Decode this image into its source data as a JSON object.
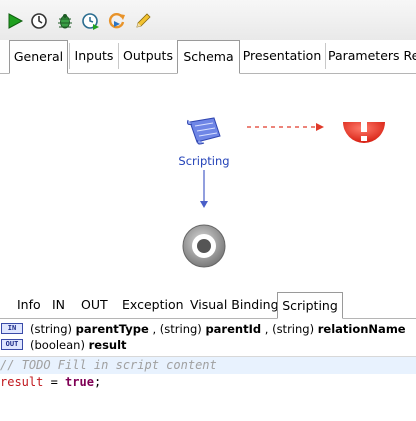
{
  "toolbar": {
    "icons": [
      "run-icon",
      "history-icon",
      "debug-icon",
      "schedule-icon",
      "refresh-icon",
      "edit-icon"
    ]
  },
  "top_tabs": [
    "General",
    "Inputs",
    "Outputs",
    "Schema",
    "Presentation",
    "Parameters Re"
  ],
  "top_tabs_selected": "Schema",
  "schema": {
    "node_label": "Scripting"
  },
  "bottom_tabs": [
    "Info",
    "IN",
    "OUT",
    "Exception",
    "Visual Binding",
    "Scripting"
  ],
  "bottom_tabs_selected": "Scripting",
  "params": {
    "in_icon": "IN",
    "out_icon": "OUT",
    "in_t1": "(string)",
    "in_n1": "parentType",
    "in_sep1": ",",
    "in_t2": "(string)",
    "in_n2": "parentId",
    "in_sep2": ",",
    "in_t3": "(string)",
    "in_n3": "relationName",
    "out_t1": "(boolean)",
    "out_n1": "result"
  },
  "editor": {
    "comment": "// TODO Fill in script content",
    "code_var": "result",
    "code_op": " = ",
    "code_kw": "true",
    "code_end": ";"
  }
}
